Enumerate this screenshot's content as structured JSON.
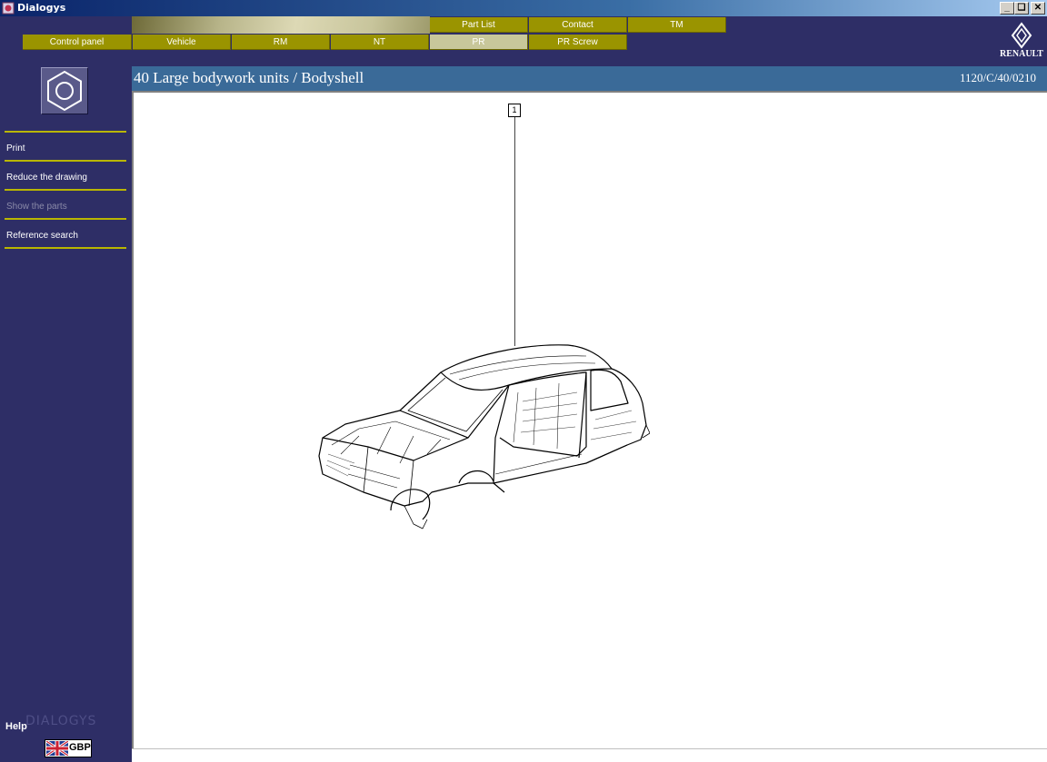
{
  "window": {
    "title": "Dialogys",
    "controls": [
      "minimize",
      "restore",
      "close"
    ]
  },
  "nav": {
    "top_row": [
      {
        "id": "part-list",
        "label": "Part List"
      },
      {
        "id": "contact",
        "label": "Contact"
      },
      {
        "id": "tm",
        "label": "TM"
      }
    ],
    "bottom_row": [
      {
        "id": "control-panel",
        "label": "Control panel"
      },
      {
        "id": "vehicle",
        "label": "Vehicle"
      },
      {
        "id": "rm",
        "label": "RM"
      },
      {
        "id": "nt",
        "label": "NT"
      },
      {
        "id": "pr",
        "label": "PR",
        "active": true
      },
      {
        "id": "pr-screw",
        "label": "PR Screw"
      }
    ]
  },
  "brand": {
    "wordmark": "RENAULT"
  },
  "sidebar": {
    "icon": "hex-nut-icon",
    "items": [
      {
        "label": "Print",
        "enabled": true
      },
      {
        "label": "Reduce the drawing",
        "enabled": true
      },
      {
        "label": "Show the parts",
        "enabled": false
      },
      {
        "label": "Reference search",
        "enabled": true
      }
    ],
    "help_label": "Help",
    "watermark": "DIALOGYS",
    "currency": {
      "code": "GBP",
      "flag": "uk-flag-icon"
    }
  },
  "heading": {
    "title": "40 Large bodywork units / Bodyshell",
    "reference": "1120/C/40/0210"
  },
  "drawing": {
    "callout": "1",
    "illustration": "bodyshell-drawing"
  },
  "colors": {
    "background": "#2e2e66",
    "tab": "#9a9400",
    "tab_active": "#c8c79a",
    "heading": "#3a6a98",
    "separator": "#b9b600"
  }
}
